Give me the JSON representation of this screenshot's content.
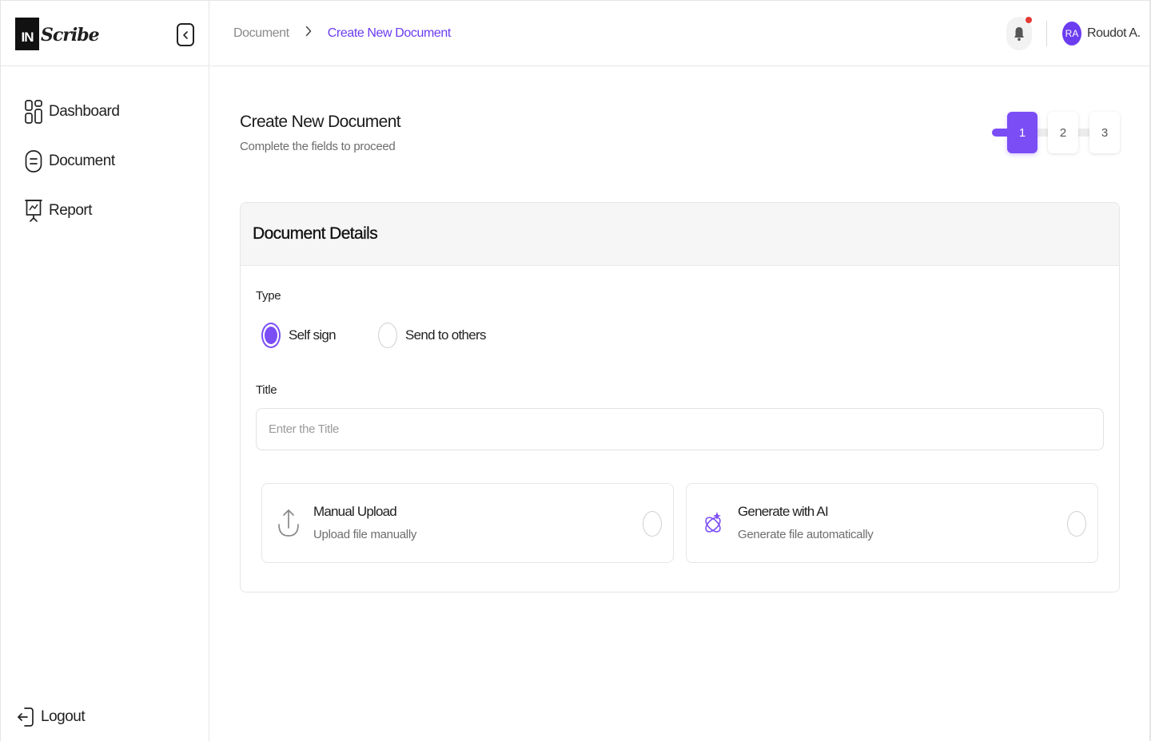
{
  "brand": {
    "logo_mark": "IN",
    "logo_text": "Scribe"
  },
  "sidebar": {
    "collapse_icon": "sidebar-collapse-icon",
    "items": [
      {
        "label": "Dashboard",
        "icon": "dashboard-grid-icon"
      },
      {
        "label": "Document",
        "icon": "document-icon"
      },
      {
        "label": "Report",
        "icon": "presentation-chart-icon"
      }
    ],
    "logout_label": "Logout"
  },
  "header": {
    "breadcrumb": [
      "Document",
      "Create New Document"
    ],
    "breadcrumb_separator": "›",
    "notification_icon": "bell-icon",
    "has_unread": true,
    "user": {
      "initials": "RA",
      "name": "Roudot A."
    }
  },
  "page": {
    "title": "Create New Document",
    "subtitle": "Complete the fields to proceed",
    "steps": [
      "1",
      "2",
      "3"
    ],
    "active_step": 1
  },
  "form": {
    "section_title": "Document Details",
    "type_label": "Type",
    "type_options": [
      {
        "label": "Self sign",
        "selected": true
      },
      {
        "label": "Send to others",
        "selected": false
      }
    ],
    "title_label": "Title",
    "title_value": "",
    "title_placeholder": "Enter the Title",
    "source_options": [
      {
        "title": "Manual Upload",
        "subtitle": "Upload file manually",
        "icon": "upload-arrow-icon",
        "selected": false
      },
      {
        "title": "Generate with AI",
        "subtitle": "Generate file automatically",
        "icon": "ai-sparkle-icon",
        "selected": false
      }
    ]
  },
  "colors": {
    "accent": "#7b4df5",
    "link": "#6b3cf0",
    "notification_dot": "#e53935"
  }
}
